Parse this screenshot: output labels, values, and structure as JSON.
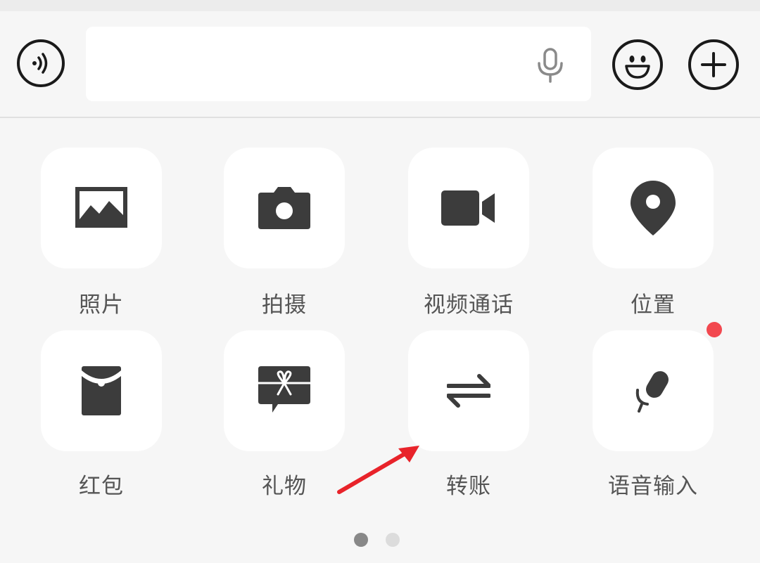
{
  "input_bar": {
    "voice_icon": "voice-wave-icon",
    "mic_icon": "microphone-icon",
    "emoji_icon": "smiley-icon",
    "plus_icon": "plus-icon",
    "text_value": ""
  },
  "panel": {
    "items": [
      {
        "label": "照片",
        "icon": "image-icon"
      },
      {
        "label": "拍摄",
        "icon": "camera-icon"
      },
      {
        "label": "视频通话",
        "icon": "video-camera-icon"
      },
      {
        "label": "位置",
        "icon": "location-pin-icon"
      },
      {
        "label": "红包",
        "icon": "red-envelope-icon"
      },
      {
        "label": "礼物",
        "icon": "gift-icon"
      },
      {
        "label": "转账",
        "icon": "transfer-arrows-icon"
      },
      {
        "label": "语音输入",
        "icon": "microphone-icon"
      }
    ],
    "page_indicator": {
      "current": 1,
      "total": 2
    }
  },
  "colors": {
    "background": "#f6f6f6",
    "tile": "#ffffff",
    "icon": "#3c3c3c",
    "label": "#555555",
    "notification_dot": "#f2484f",
    "annotation_arrow": "#e8232a"
  }
}
